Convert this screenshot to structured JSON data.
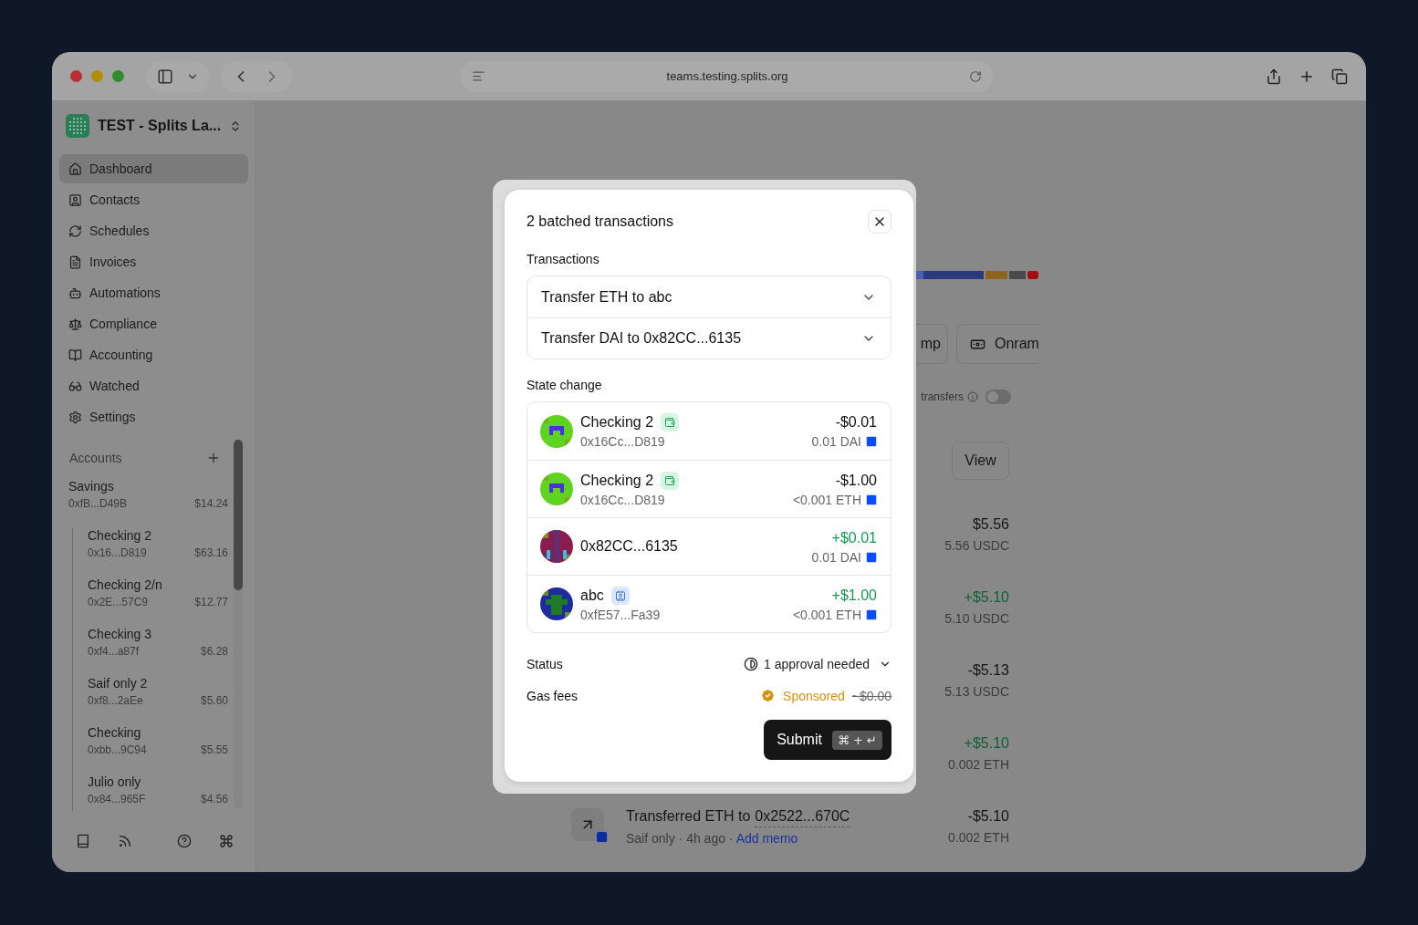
{
  "browser": {
    "url": "teams.testing.splits.org"
  },
  "sidebar": {
    "workspace": "TEST - Splits La...",
    "nav": [
      {
        "label": "Dashboard",
        "selected": true
      },
      {
        "label": "Contacts",
        "selected": false
      },
      {
        "label": "Schedules",
        "selected": false
      },
      {
        "label": "Invoices",
        "selected": false
      },
      {
        "label": "Automations",
        "selected": false
      },
      {
        "label": "Compliance",
        "selected": false
      },
      {
        "label": "Accounting",
        "selected": false
      },
      {
        "label": "Watched",
        "selected": false
      },
      {
        "label": "Settings",
        "selected": false
      }
    ],
    "accounts_heading": "Accounts",
    "accounts": [
      {
        "name": "Savings",
        "address": "0xfB...D49B",
        "balance": "$14.24",
        "children": [
          {
            "name": "Checking 2",
            "address": "0x16...D819",
            "balance": "$63.16"
          },
          {
            "name": "Checking 2/n",
            "address": "0x2E...57C9",
            "balance": "$12.77"
          },
          {
            "name": "Checking 3",
            "address": "0xf4...a87f",
            "balance": "$6.28"
          },
          {
            "name": "Saif only 2",
            "address": "0xf8...2aEe",
            "balance": "$5.60"
          },
          {
            "name": "Checking",
            "address": "0xbb...9C94",
            "balance": "$5.55"
          },
          {
            "name": "Julio only",
            "address": "0x84...965F",
            "balance": "$4.56"
          }
        ]
      }
    ]
  },
  "main": {
    "buttons": [
      "mp",
      "Onram"
    ],
    "toggle": {
      "label": "transfers",
      "on": false
    },
    "view_button": "View",
    "activity": [
      {
        "amount": "$5.56",
        "positive": false,
        "sub": "5.56 USDC"
      },
      {
        "amount": "+$5.10",
        "positive": true,
        "sub": "5.10 USDC"
      },
      {
        "amount": "-$5.13",
        "positive": false,
        "sub": "5.13 USDC"
      },
      {
        "amount": "+$5.10",
        "positive": true,
        "sub": "0.002 ETH"
      },
      {
        "title": "Transferred ETH to",
        "address": "0x2522...670C",
        "meta": "Saif only · 4h ago ·",
        "link": "Add memo",
        "amount": "-$5.10",
        "positive": false,
        "sub": "0.002 ETH"
      }
    ]
  },
  "modal": {
    "title": "2 batched transactions",
    "transactions_heading": "Transactions",
    "transactions": [
      "Transfer ETH to abc",
      "Transfer DAI to 0x82CC...6135"
    ],
    "state_heading": "State change",
    "state_changes": [
      {
        "kind": "wallet",
        "name": "Checking 2",
        "address": "0x16Cc...D819",
        "color": "#5fd41e",
        "amount": "-$0.01",
        "positive": false,
        "token": "0.01 DAI"
      },
      {
        "kind": "wallet",
        "name": "Checking 2",
        "address": "0x16Cc...D819",
        "color": "#5fd41e",
        "amount": "-$1.00",
        "positive": false,
        "token": "<0.001 ETH"
      },
      {
        "kind": "address",
        "name": "0x82CC...6135",
        "color": "#8b1c4e",
        "amount": "+$0.01",
        "positive": true,
        "token": "0.01 DAI"
      },
      {
        "kind": "contact",
        "name": "abc",
        "address": "0xfE57...Fa39",
        "color": "#1d2aa0",
        "amount": "+$1.00",
        "positive": true,
        "token": "<0.001 ETH"
      }
    ],
    "status_label": "Status",
    "status": "1 approval needed",
    "gas_label": "Gas fees",
    "gas_status": "Sponsored",
    "gas_amount": "~$0.00",
    "submit": "Submit",
    "shortcut": "⌘ + ↵"
  }
}
